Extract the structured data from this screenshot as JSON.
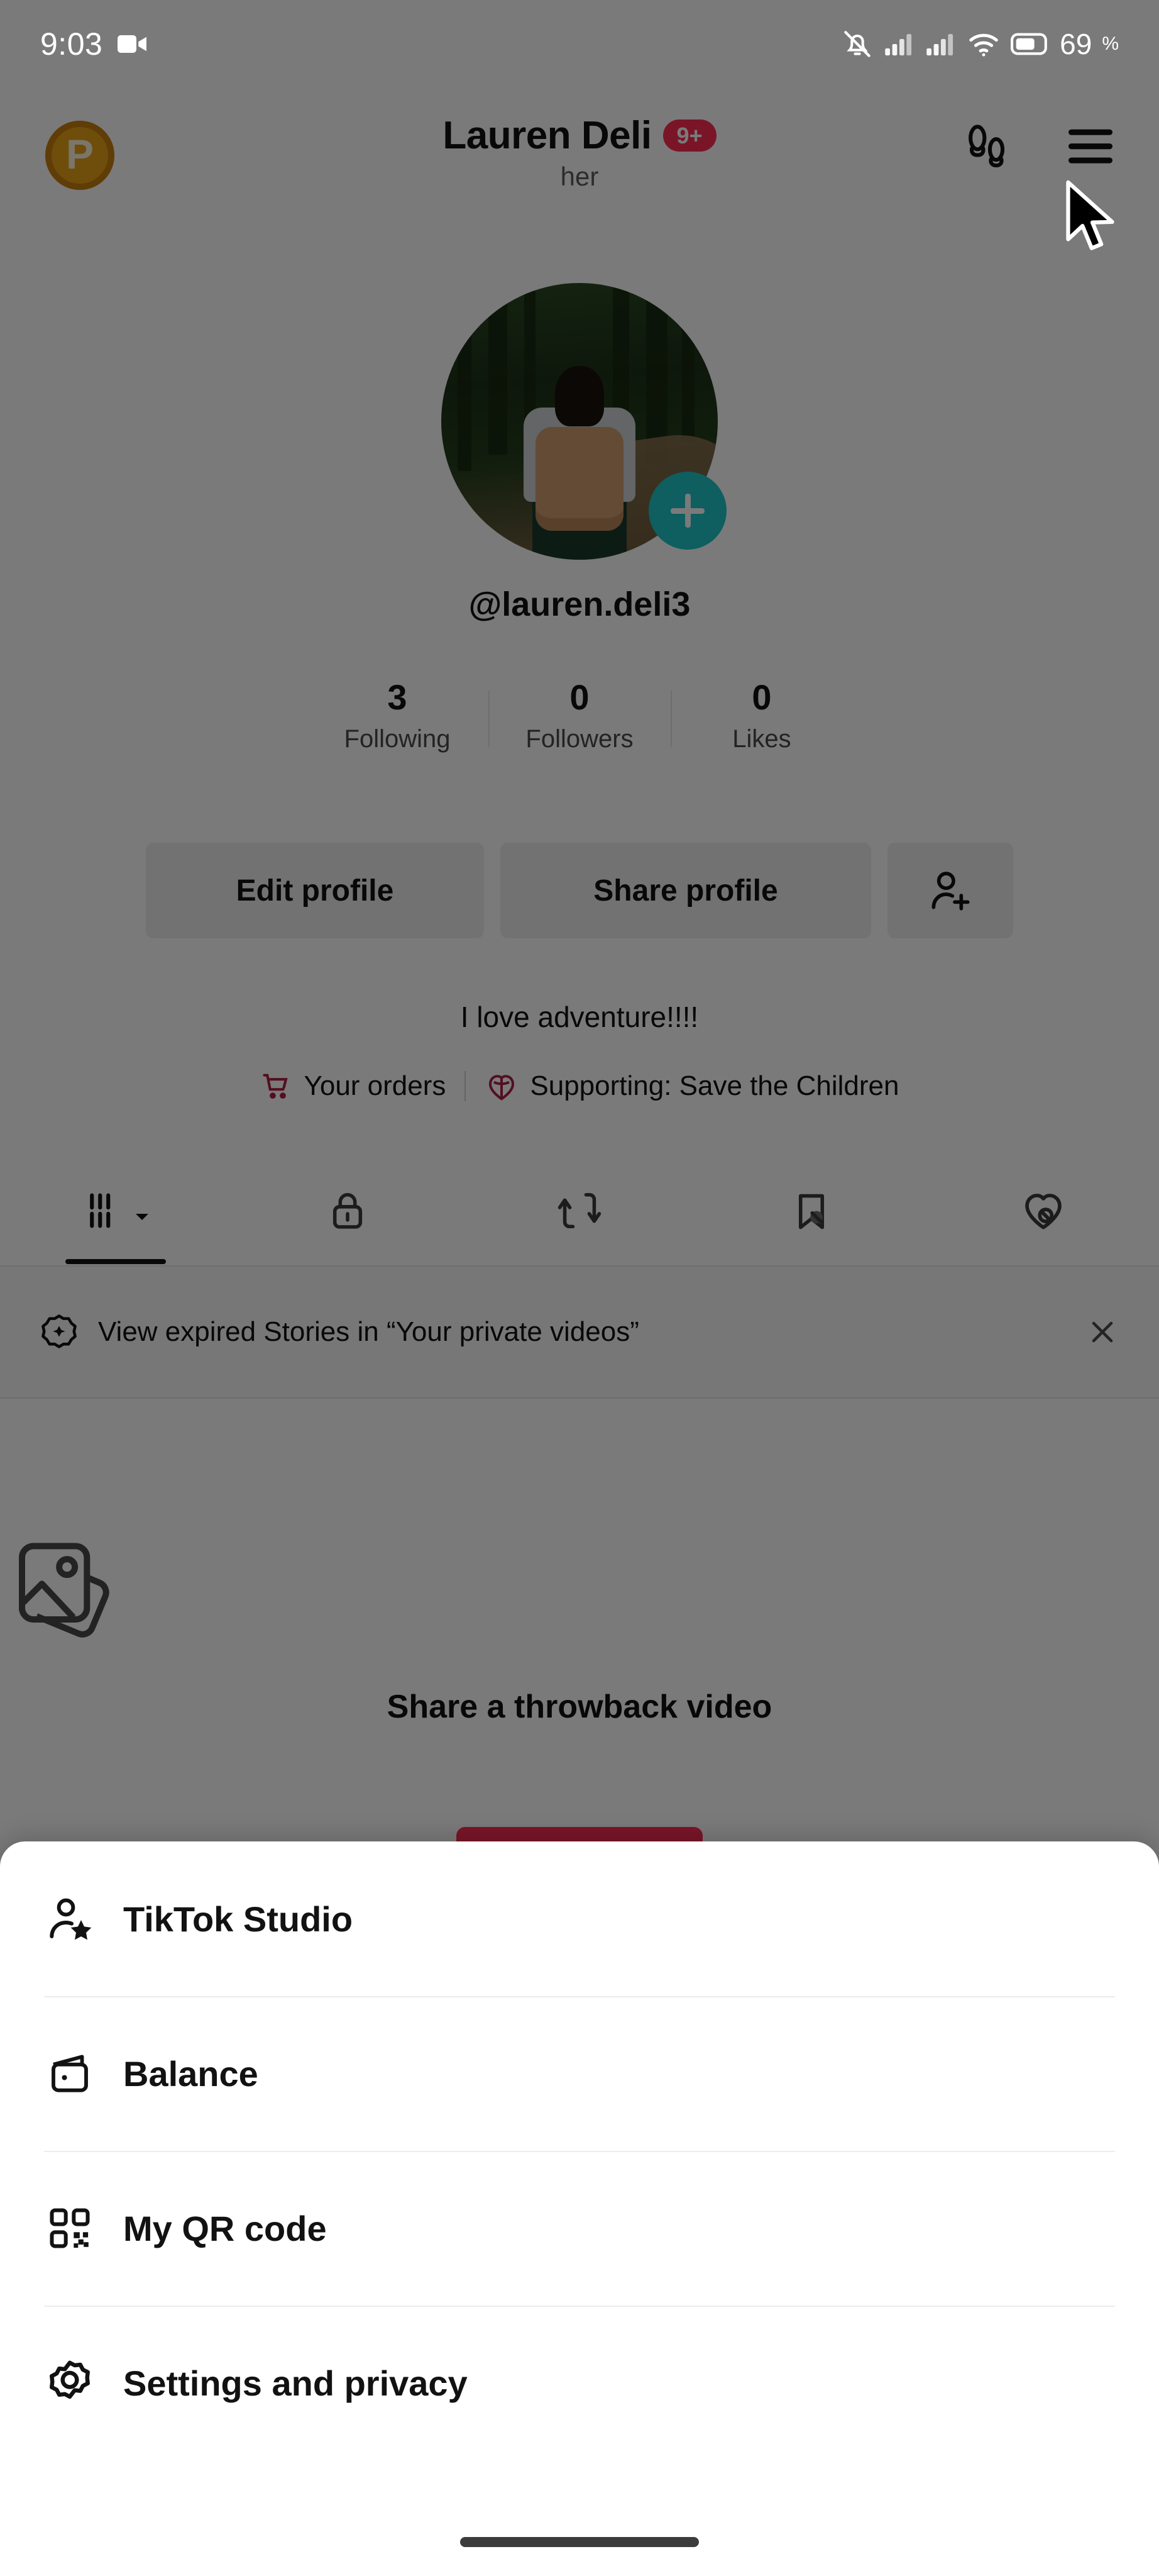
{
  "status_bar": {
    "time": "9:03",
    "icons": [
      "video-record-icon",
      "notifications-muted-icon",
      "cellular-signal-icon",
      "cellular-signal-2-icon",
      "wifi-icon",
      "battery-icon"
    ],
    "battery_level": "69",
    "battery_unit": "%"
  },
  "header": {
    "coin_label": "P",
    "coin_icon": "rewards-coin-icon",
    "title": "Lauren Deli",
    "badge": "9+",
    "pronoun": "her",
    "footprints_icon": "footprints-icon",
    "menu_icon": "hamburger-menu-icon"
  },
  "profile": {
    "avatar_alt": "hiker-in-forest-avatar",
    "add_story_icon": "plus-icon",
    "handle": "@lauren.deli3",
    "bio": "I love adventure!!!!",
    "stats": [
      {
        "value": "3",
        "label": "Following"
      },
      {
        "value": "0",
        "label": "Followers"
      },
      {
        "value": "0",
        "label": "Likes"
      }
    ],
    "buttons": {
      "edit_profile": "Edit profile",
      "share_profile": "Share profile",
      "add_friends_icon": "add-person-icon"
    },
    "meta": {
      "orders_label": "Your orders",
      "orders_icon": "shopping-cart-icon",
      "supporting_label": "Supporting: Save the Children",
      "supporting_icon": "charity-heart-icon"
    },
    "tabs": [
      {
        "icon": "grid-videos-icon",
        "name": "videos-tab",
        "active": true
      },
      {
        "icon": "lock-private-icon",
        "name": "private-tab",
        "active": false
      },
      {
        "icon": "repost-icon",
        "name": "reposts-tab",
        "active": false
      },
      {
        "icon": "bookmark-hidden-icon",
        "name": "favorites-tab",
        "active": false
      },
      {
        "icon": "heart-hidden-icon",
        "name": "liked-tab",
        "active": false
      }
    ]
  },
  "banner": {
    "icon": "story-circle-star-icon",
    "text": "View expired Stories in “Your private videos”",
    "close_icon": "close-icon"
  },
  "empty_state": {
    "icon": "stacked-photos-icon",
    "text": "Share a throwback video",
    "button_label": ""
  },
  "sheet": {
    "items": [
      {
        "label": "TikTok Studio",
        "icon": "person-star-icon",
        "name": "tiktok-studio"
      },
      {
        "label": "Balance",
        "icon": "wallet-icon",
        "name": "balance"
      },
      {
        "label": "My QR code",
        "icon": "qr-code-icon",
        "name": "my-qr-code"
      },
      {
        "label": "Settings and privacy",
        "icon": "gear-icon",
        "name": "settings-and-privacy"
      }
    ]
  },
  "colors": {
    "accent_red": "#fe2c55",
    "coin_gold": "#e8a317",
    "story_teal": "#20c4c9",
    "sheet_bg": "#ffffff",
    "overlay": "rgba(0,0,0,0.52)"
  },
  "cursor": {
    "icon": "mouse-pointer-icon"
  }
}
